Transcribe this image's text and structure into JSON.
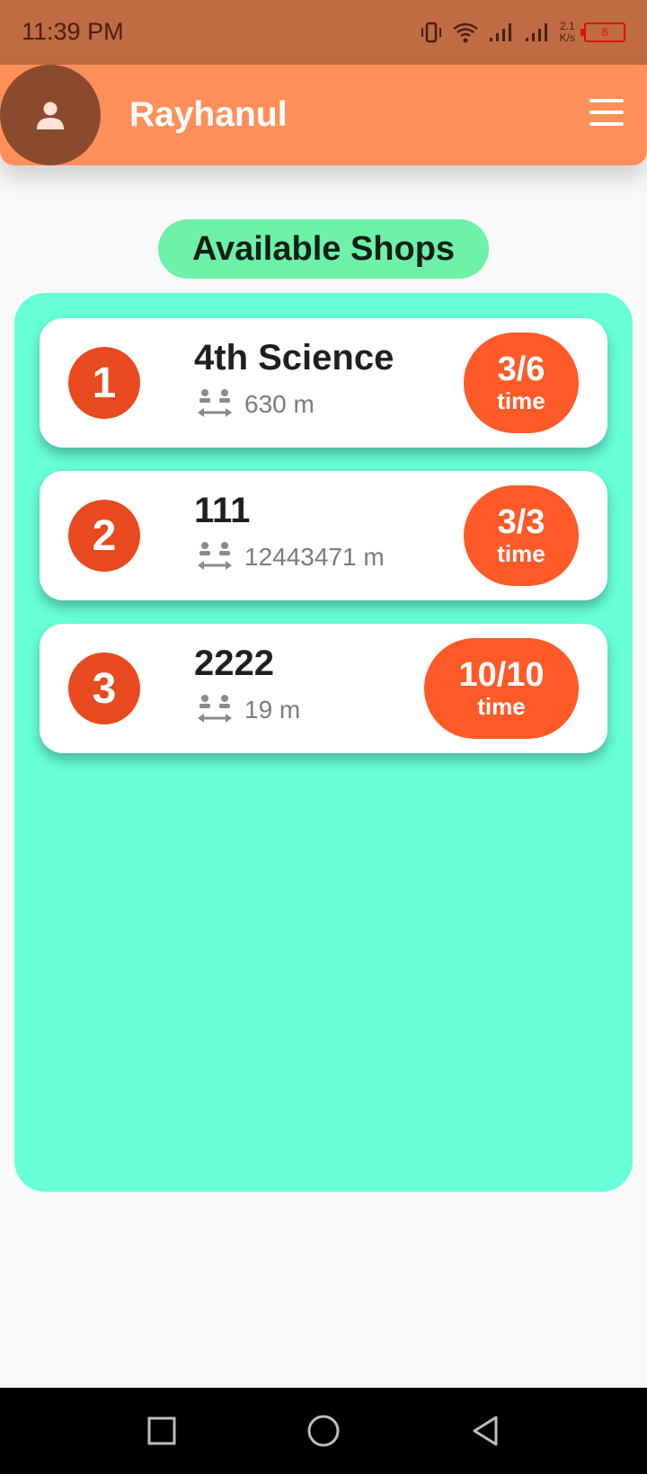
{
  "status_bar": {
    "time": "11:39 PM",
    "net_speed_value": "2.1",
    "net_speed_unit": "K/s",
    "battery_level": "8"
  },
  "header": {
    "user_name": "Rayhanul",
    "avatar_icon": "person-icon",
    "menu_icon": "hamburger-menu-icon"
  },
  "section_title": "Available Shops",
  "shops": [
    {
      "rank": "1",
      "name": "4th Science",
      "distance": "630 m",
      "times": "3/6",
      "times_unit": "time"
    },
    {
      "rank": "2",
      "name": "111",
      "distance": "12443471 m",
      "times": "3/3",
      "times_unit": "time"
    },
    {
      "rank": "3",
      "name": "2222",
      "distance": "19 m",
      "times": "10/10",
      "times_unit": "time"
    }
  ],
  "colors": {
    "status_bar": "#bf6b43",
    "app_bar": "#ff8f59",
    "avatar": "#8a4a2e",
    "section_pill": "#6ff0a8",
    "panel": "#67ffd8",
    "rank_circle": "#e8491e",
    "times_badge": "#ff5a27"
  },
  "nav_bar": {
    "recent_icon": "square-recents-icon",
    "home_icon": "circle-home-icon",
    "back_icon": "triangle-back-icon"
  }
}
